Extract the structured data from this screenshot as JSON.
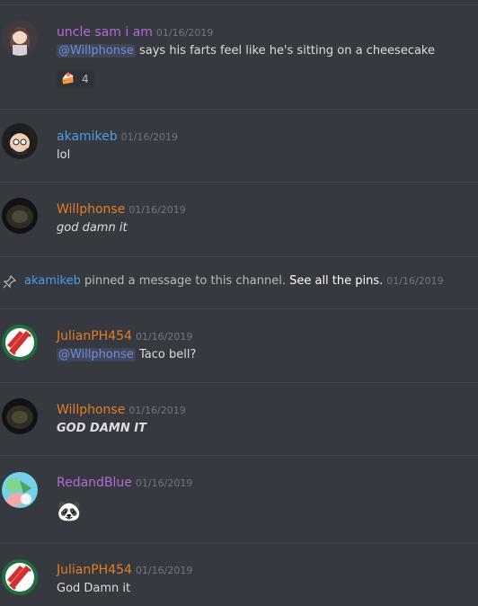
{
  "colors": {
    "background": "#36393f",
    "purple": "#b36ad7",
    "blue": "#4a9ee6",
    "orange": "#e67e22",
    "mention": "#7289da"
  },
  "pinned": {
    "user": "akamikeb",
    "text": " pinned a message to this channel. ",
    "link": "See all the pins.",
    "timestamp": "01/16/2019",
    "icon": "pin-icon"
  },
  "messages": [
    {
      "author": "uncle sam i am",
      "timestamp": "01/16/2019",
      "mention": "@Willphonse",
      "text": " says his farts feel like he's sitting on a cheesecake",
      "reaction": {
        "emoji": "🍰",
        "count": "4"
      }
    },
    {
      "author": "akamikeb",
      "timestamp": "01/16/2019",
      "text": "lol"
    },
    {
      "author": "Willphonse",
      "timestamp": "01/16/2019",
      "text": "god damn it"
    },
    {
      "author": "JulianPH454",
      "timestamp": "01/16/2019",
      "mention": "@Willphonse",
      "text": " Taco bell?"
    },
    {
      "author": "Willphonse",
      "timestamp": "01/16/2019",
      "text": "GOD DAMN IT"
    },
    {
      "author": "RedandBlue",
      "timestamp": "01/16/2019",
      "emoji": "🐼"
    },
    {
      "author": "JulianPH454",
      "timestamp": "01/16/2019",
      "text": "God Damn it"
    }
  ]
}
